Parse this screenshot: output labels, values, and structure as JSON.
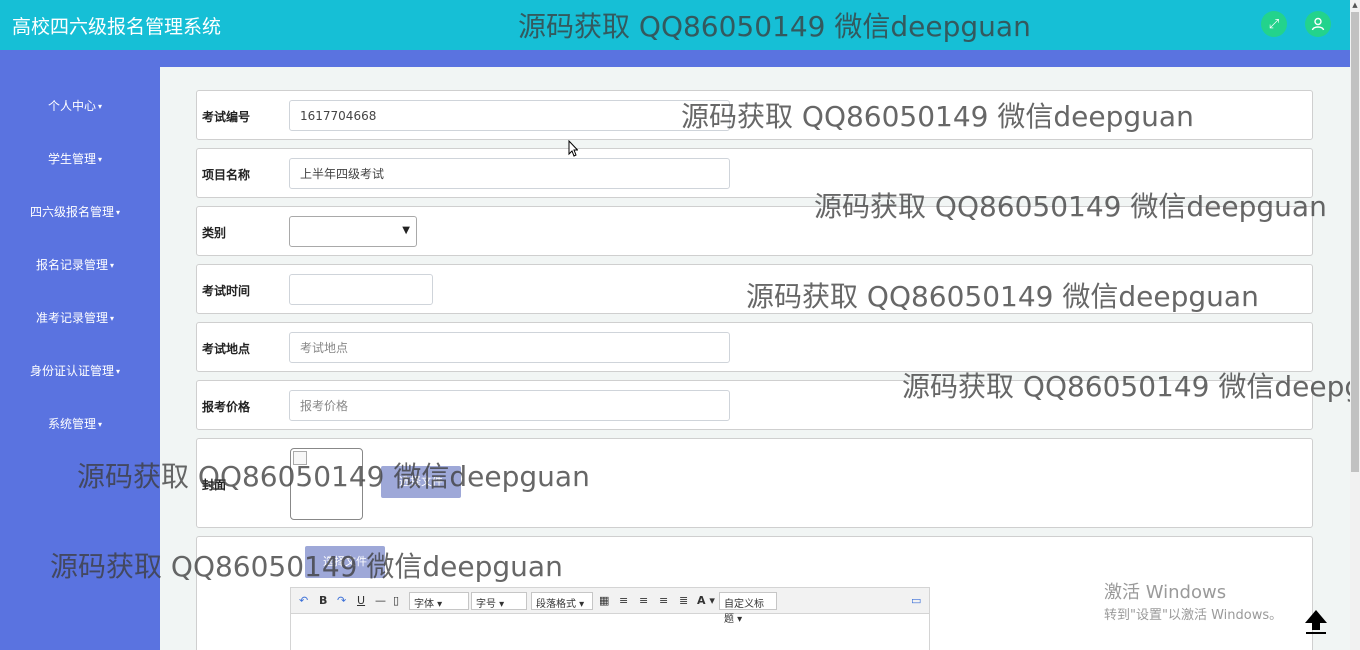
{
  "header": {
    "title": "高校四六级报名管理系统",
    "fullscreen_icon": "expand-icon",
    "user_icon": "user-icon"
  },
  "sidebar": {
    "items": [
      {
        "label": "个人中心"
      },
      {
        "label": "学生管理"
      },
      {
        "label": "四六级报名管理"
      },
      {
        "label": "报名记录管理"
      },
      {
        "label": "准考记录管理"
      },
      {
        "label": "身份证认证管理"
      },
      {
        "label": "系统管理"
      }
    ]
  },
  "form": {
    "exam_no": {
      "label": "考试编号",
      "value": "1617704668"
    },
    "project_name": {
      "label": "项目名称",
      "value": "上半年四级考试"
    },
    "category": {
      "label": "类别",
      "value": ""
    },
    "exam_time": {
      "label": "考试时间",
      "value": ""
    },
    "exam_location": {
      "label": "考试地点",
      "placeholder": "考试地点"
    },
    "price": {
      "label": "报考价格",
      "placeholder": "报考价格"
    },
    "cover": {
      "label": "封面",
      "button": "选择文件"
    },
    "detail": {
      "button": "选择文件"
    }
  },
  "editor": {
    "font": "字体",
    "size": "字号",
    "paragraph": "段落格式",
    "custom": "自定义标题"
  },
  "watermark": "源码获取 QQ86050149 微信deepguan",
  "windows": {
    "line1": "激活 Windows",
    "line2": "转到\"设置\"以激活 Windows。"
  },
  "colors": {
    "header": "#16bfd6",
    "sidebar": "#5a73e0",
    "accent_green": "#23d38c"
  }
}
